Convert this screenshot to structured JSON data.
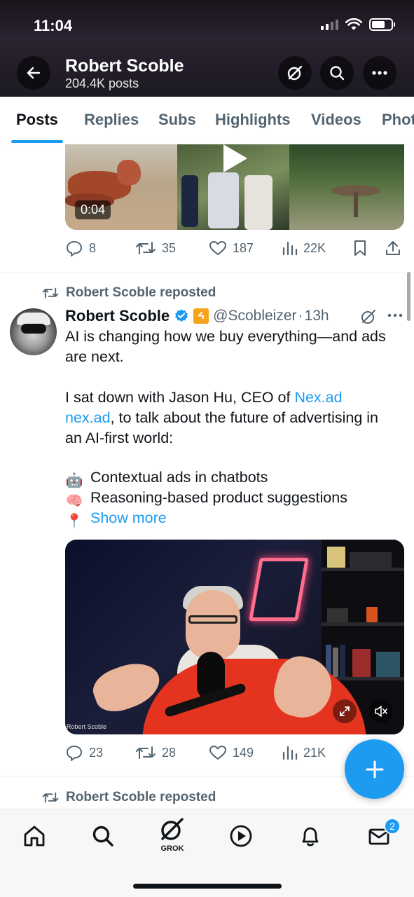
{
  "status_bar": {
    "time": "11:04"
  },
  "header": {
    "name": "Robert Scoble",
    "post_count": "204.4K posts"
  },
  "tabs": [
    "Posts",
    "Replies",
    "Subs",
    "Highlights",
    "Videos",
    "Photos"
  ],
  "previous_post": {
    "video_duration": "0:04",
    "replies": "8",
    "reposts": "35",
    "likes": "187",
    "views": "22K"
  },
  "post": {
    "repost_label": "Robert Scoble reposted",
    "author_name": "Robert Scoble",
    "affiliate_badge": "ᔦ",
    "handle": "@Scobleizer",
    "separator": "·",
    "time": "13h",
    "text_line1": "AI is changing how we buy everything—and ads",
    "text_line2": "are next.",
    "text_line3_prefix": "I sat down with Jason Hu, CEO of ",
    "text_link1": "Nex.ad",
    "text_link2": "nex.ad",
    "text_line4_suffix": ", to talk about the future of advertising in",
    "text_line5": "an AI-first world:",
    "bullet1_emoji": "🤖",
    "bullet1": "Contextual ads in chatbots",
    "bullet2_emoji": "🧠",
    "bullet2": "Reasoning-based product suggestions",
    "bullet3_emoji": "📍",
    "show_more": "Show more",
    "video_caption": "Robert Scoble",
    "replies": "23",
    "reposts": "28",
    "likes": "149",
    "views": "21K"
  },
  "next_post": {
    "repost_label": "Robert Scoble reposted"
  },
  "bottom_nav": {
    "grok_label": "GROK",
    "messages_badge": "2"
  },
  "colors": {
    "accent": "#1d9bf0",
    "text": "#0f1419",
    "muted": "#536471"
  }
}
